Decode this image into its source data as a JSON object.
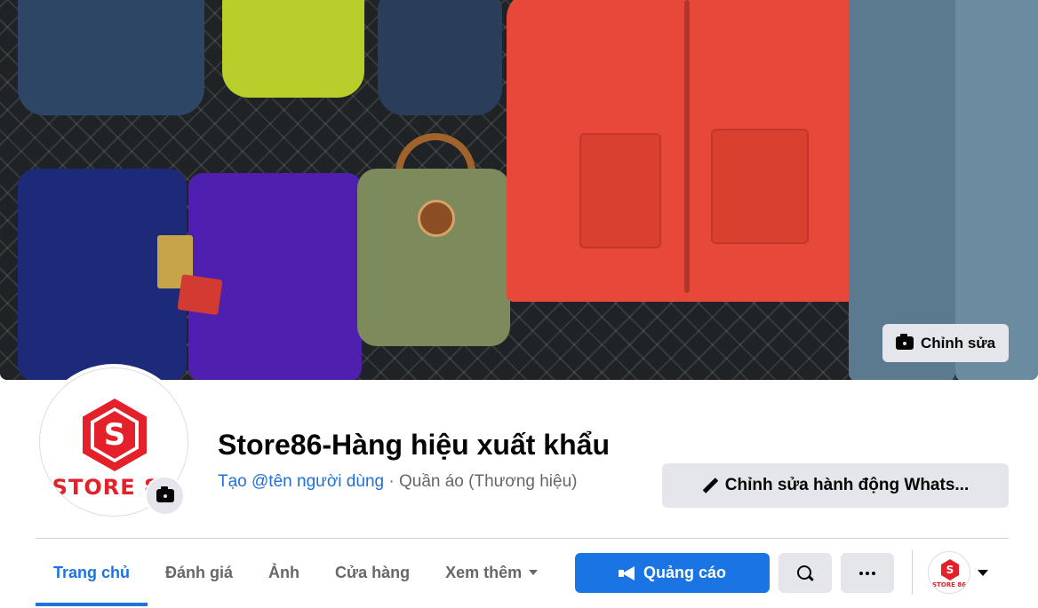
{
  "cover": {
    "edit_label": "Chỉnh sửa"
  },
  "profile": {
    "logo_letter": "S",
    "logo_text": "STORE 86",
    "title": "Store86-Hàng hiệu xuất khẩu",
    "username_link": "Tạo @tên người dùng",
    "separator": " · ",
    "category": "Quần áo (Thương hiệu)",
    "edit_action_label": "Chỉnh sửa hành động Whats..."
  },
  "tabs": [
    {
      "label": "Trang chủ",
      "active": true
    },
    {
      "label": "Đánh giá"
    },
    {
      "label": "Ảnh"
    },
    {
      "label": "Cửa hàng"
    },
    {
      "label": "Xem thêm"
    }
  ],
  "actions": {
    "ad_label": "Quảng cáo"
  },
  "mini_avatar": {
    "letter": "S",
    "text": "STORE 86"
  },
  "colors": {
    "accent": "#1b74e4",
    "brand_red": "#e4202b",
    "button_gray": "#e4e6eb",
    "secondary_text": "#65676b"
  }
}
